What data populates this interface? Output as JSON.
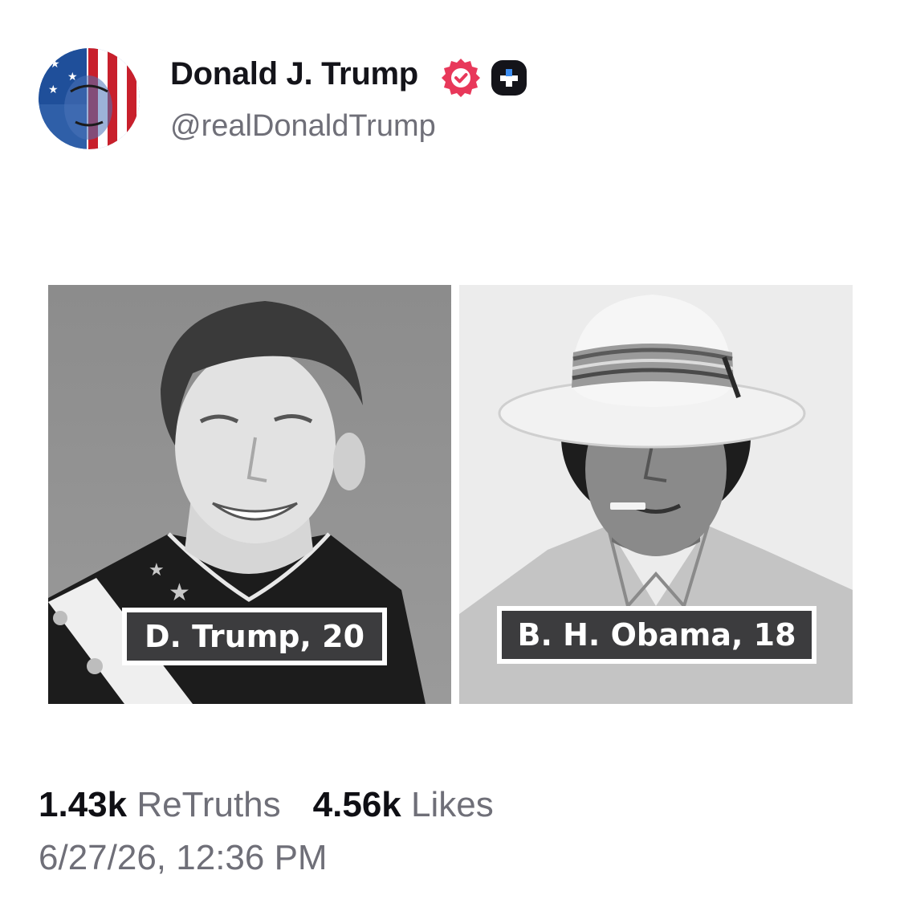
{
  "post": {
    "author": {
      "display_name": "Donald J. Trump",
      "handle": "@realDonaldTrump",
      "verified_icon": "verified-badge-icon",
      "plus_icon": "plus-badge-icon",
      "verified_color": "#e8385a"
    },
    "media": {
      "captions": [
        "D. Trump, 20",
        "B. H. Obama, 18"
      ]
    },
    "stats": {
      "retruths_count": "1.43k",
      "retruths_label": "ReTruths",
      "likes_count": "4.56k",
      "likes_label": "Likes"
    },
    "timestamp": "6/27/26, 12:36 PM"
  }
}
